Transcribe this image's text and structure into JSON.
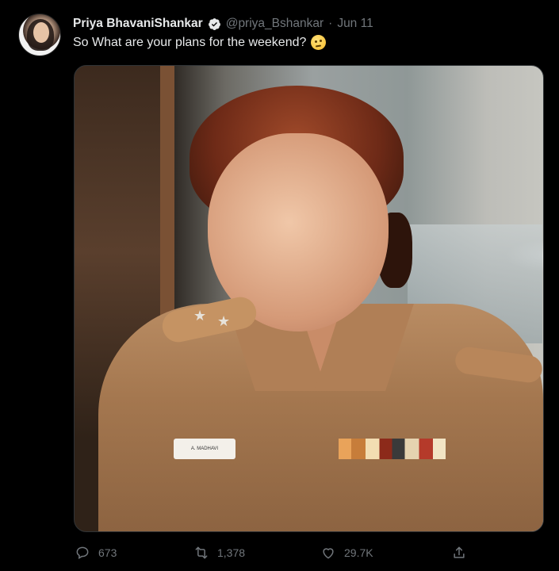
{
  "tweet": {
    "author": {
      "name": "Priya BhavaniShankar",
      "handle": "@priya_Bshankar",
      "verified": true,
      "avatar_icon": "profile-photo"
    },
    "separator": "·",
    "date": "Jun 11",
    "text": "So What are your plans for the weekend?",
    "emoji": "face-with-raised-eyebrow",
    "media": {
      "type": "photo",
      "nametag_text": "A. MADHAVI"
    },
    "actions": {
      "replies": "673",
      "retweets": "1,378",
      "likes": "29.7K"
    }
  },
  "colors": {
    "background": "#000000",
    "text_primary": "#e7e9ea",
    "text_secondary": "#71767b",
    "verified_blue": "#1d9bf0"
  }
}
